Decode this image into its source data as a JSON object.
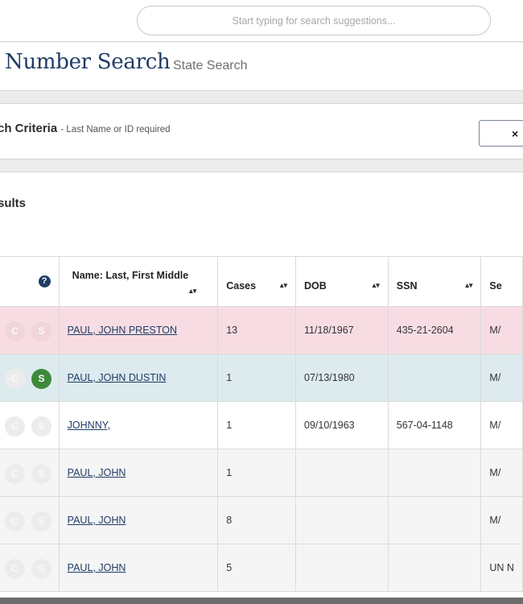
{
  "search": {
    "placeholder": "Start typing for search suggestions..."
  },
  "page": {
    "title": "Number Search",
    "subtitle": "State Search"
  },
  "criteria": {
    "title": "ch Criteria",
    "note": "- Last Name or ID required",
    "clear_icon": "×"
  },
  "results": {
    "title": "sults"
  },
  "table": {
    "help_icon": "?",
    "sort_icon": "▴▾",
    "headers": {
      "name": "Name: Last, First Middle",
      "cases": "Cases",
      "dob": "DOB",
      "ssn": "SSN",
      "sex": "Se"
    },
    "badges": {
      "c": "C",
      "s": "S"
    },
    "rows": [
      {
        "name": "PAUL, JOHN PRESTON",
        "cases": "13",
        "dob": "11/18/1967",
        "ssn": "435-21-2604",
        "sex": "M/",
        "s_active": false,
        "style": "pink"
      },
      {
        "name": "PAUL, JOHN DUSTIN",
        "cases": "1",
        "dob": "07/13/1980",
        "ssn": "",
        "sex": "M/",
        "s_active": true,
        "style": "blue"
      },
      {
        "name": "JOHNNY,",
        "cases": "1",
        "dob": "09/10/1963",
        "ssn": "567-04-1148",
        "sex": "M/",
        "s_active": false,
        "style": "white"
      },
      {
        "name": "PAUL, JOHN",
        "cases": "1",
        "dob": "",
        "ssn": "",
        "sex": "M/",
        "s_active": false,
        "style": "gray"
      },
      {
        "name": "PAUL, JOHN",
        "cases": "8",
        "dob": "",
        "ssn": "",
        "sex": "M/",
        "s_active": false,
        "style": "gray"
      },
      {
        "name": "PAUL, JOHN",
        "cases": "5",
        "dob": "",
        "ssn": "",
        "sex": "UN N",
        "s_active": false,
        "style": "gray"
      }
    ]
  },
  "colors": {
    "accent": "#1f3c66",
    "row_pink": "#f7dde3",
    "row_blue": "#ddebef",
    "badge_active": "#3e8a3b"
  }
}
